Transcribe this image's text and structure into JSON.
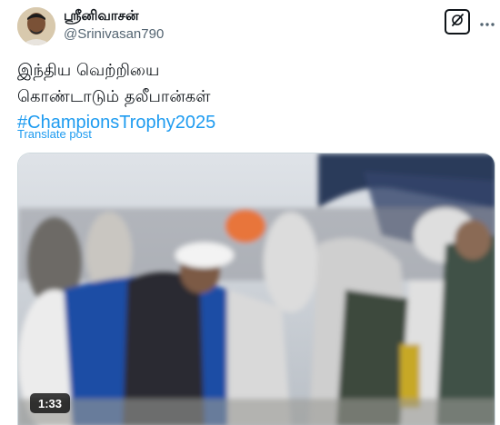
{
  "author": {
    "display_name": "ஸ்ரீனிவாசன்",
    "handle": "@Srinivasan790"
  },
  "tweet": {
    "line1": "இந்திய வெற்றியை",
    "line2": "கொண்டாடும் தலீபான்கள்",
    "hashtag": "#ChampionsTrophy2025",
    "translate_label": "Translate post"
  },
  "video": {
    "duration": "1:33"
  },
  "icons": {
    "grok": "grok-icon",
    "more": "more-options-icon"
  },
  "colors": {
    "link": "#1d9bf0",
    "text": "#0f1419",
    "secondary": "#536471"
  }
}
